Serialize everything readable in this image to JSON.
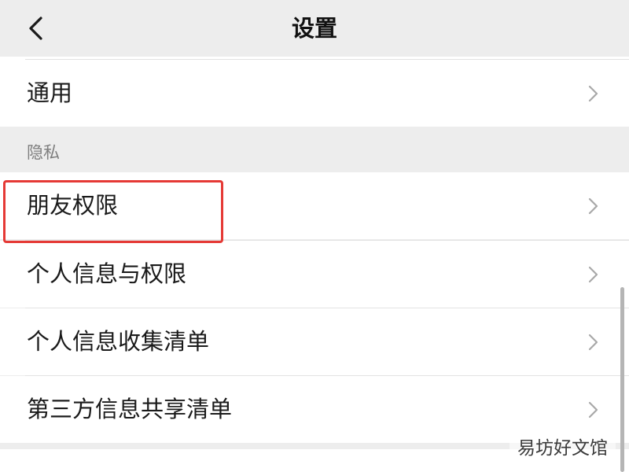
{
  "header": {
    "title": "设置",
    "back_icon": "chevron-left-icon"
  },
  "rows": {
    "general": {
      "label": "通用"
    },
    "friend_permissions": {
      "label": "朋友权限"
    },
    "personal_info_permissions": {
      "label": "个人信息与权限"
    },
    "personal_info_collection": {
      "label": "个人信息收集清单"
    },
    "third_party_sharing": {
      "label": "第三方信息共享清单"
    }
  },
  "section": {
    "privacy_label": "隐私"
  },
  "row_icon": "chevron-right-icon",
  "highlight": {
    "target": "朋友权限",
    "color": "#e53935"
  },
  "watermark": {
    "text": "易坊好文馆"
  },
  "colors": {
    "page_background": "#ededed",
    "row_background": "#ffffff",
    "text": "#1a1a1a",
    "secondary_text": "#7f7f7f",
    "chevron": "#a8a8a8"
  }
}
